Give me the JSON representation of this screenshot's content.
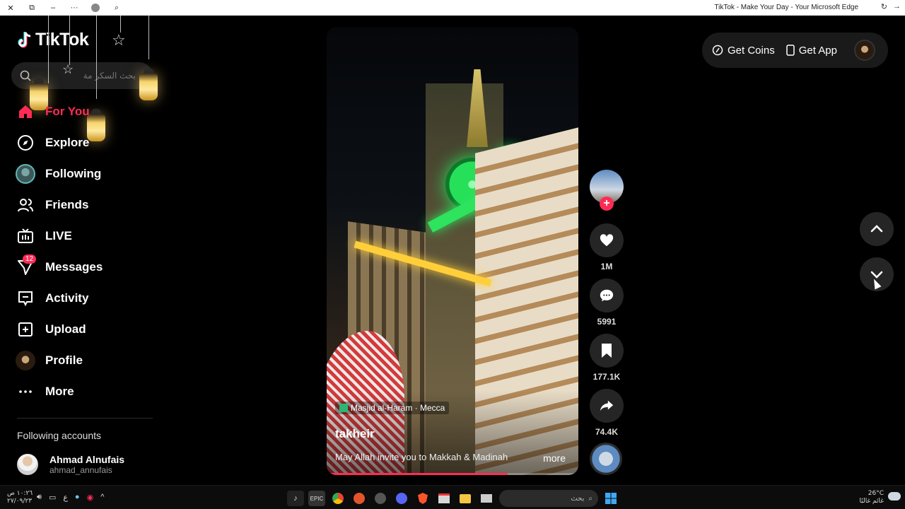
{
  "browser": {
    "title": "TikTok - Make Your Day - Your Microsoft Edge",
    "close_glyph": "✕",
    "tab_glyph": "⧉",
    "min_glyph": "–",
    "more_glyph": "···",
    "search_glyph": "⌕"
  },
  "sidebar": {
    "logo": "TikTok",
    "search_placeholder": "بحث السكر مة",
    "nav": [
      {
        "label": "For You",
        "icon": "home-icon",
        "active": true
      },
      {
        "label": "Explore",
        "icon": "compass-icon"
      },
      {
        "label": "Following",
        "icon": "following-avatar"
      },
      {
        "label": "Friends",
        "icon": "friends-icon"
      },
      {
        "label": "LIVE",
        "icon": "live-tv-icon"
      },
      {
        "label": "Messages",
        "icon": "messages-icon",
        "badge": "12"
      },
      {
        "label": "Activity",
        "icon": "activity-icon"
      },
      {
        "label": "Upload",
        "icon": "upload-icon"
      },
      {
        "label": "Profile",
        "icon": "profile-avatar"
      },
      {
        "label": "More",
        "icon": "more-dots-icon"
      }
    ],
    "following_title": "Following accounts",
    "following": [
      {
        "name": "Ahmad Alnufais",
        "handle": "ahmad_annufais"
      }
    ]
  },
  "video": {
    "location": "Masjid al-Haram · Mecca",
    "author": "takheir",
    "caption": "May Allah invite you to Makkah & Madinah",
    "more": "more",
    "progress": 0.72
  },
  "actions": {
    "follow": "+",
    "likes": "1M",
    "comments": "5991",
    "saves": "177.1K",
    "shares": "74.4K"
  },
  "topbar": {
    "coins": "Get Coins",
    "app": "Get App"
  },
  "taskbar": {
    "time": "١٠:٢٦ ص",
    "date": "٢٧/٠٩/٢٣",
    "lang": "ع",
    "search": "بحث",
    "temp": "26°C",
    "weather": "غائم غالبًا"
  },
  "colors": {
    "accent": "#fe2c55",
    "sidebar_bg": "#000000",
    "button_bg": "#252525"
  }
}
